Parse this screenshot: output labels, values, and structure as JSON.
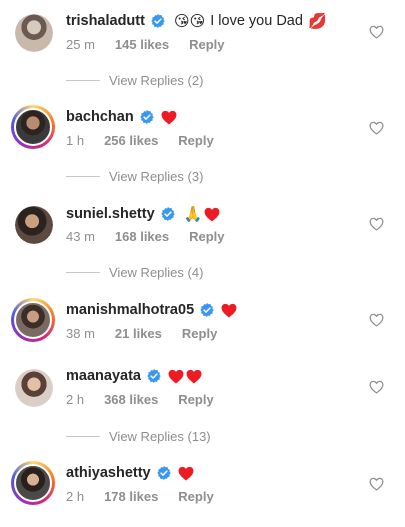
{
  "colors": {
    "verified": "#3897f0",
    "heart": "#ed1c24",
    "muted": "#8e8e8e"
  },
  "comments": [
    {
      "username": "trishaladutt",
      "text": "I love you Dad",
      "emojis_before": "😘😘",
      "emoji_after": "💋",
      "time": "25 m",
      "likes": "145 likes",
      "reply": "Reply",
      "view_replies": "View Replies (2)"
    },
    {
      "username": "bachchan",
      "emoji": "heart",
      "time": "1 h",
      "likes": "256 likes",
      "reply": "Reply",
      "view_replies": "View Replies (3)"
    },
    {
      "username": "suniel.shetty",
      "emojis_before": "🙏",
      "emoji": "heart",
      "time": "43 m",
      "likes": "168 likes",
      "reply": "Reply",
      "view_replies": "View Replies (4)"
    },
    {
      "username": "manishmalhotra05",
      "emoji": "heart",
      "time": "38 m",
      "likes": "21 likes",
      "reply": "Reply"
    },
    {
      "username": "maanayata",
      "emoji": "heart-heart",
      "time": "2 h",
      "likes": "368 likes",
      "reply": "Reply",
      "view_replies": "View Replies (13)"
    },
    {
      "username": "athiyashetty",
      "emoji": "heart",
      "time": "2 h",
      "likes": "178 likes",
      "reply": "Reply"
    }
  ],
  "icons": {
    "verified": "verified-badge-icon",
    "like": "heart-outline-icon",
    "heart": "red-heart-emoji"
  }
}
